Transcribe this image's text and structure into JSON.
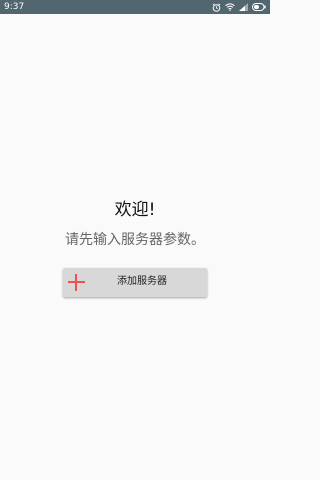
{
  "status_bar": {
    "time": "9:37",
    "icons": [
      "alarm-icon",
      "wifi-icon",
      "signal-icon",
      "battery-icon"
    ],
    "background": "#51666f"
  },
  "main": {
    "title": "欢迎!",
    "subtitle": "请先输入服务器参数。",
    "add_button": {
      "label": "添加服务器",
      "icon": "plus-icon",
      "icon_color": "#f0504f"
    }
  }
}
